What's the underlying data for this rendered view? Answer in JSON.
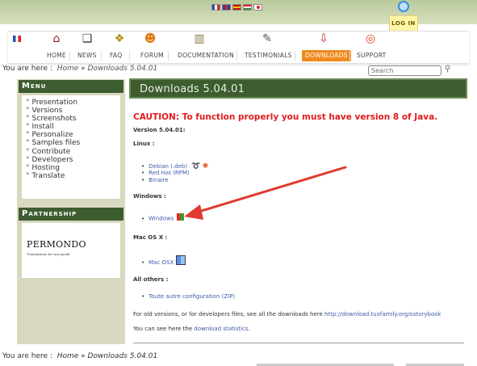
{
  "login": {
    "label": "LOG IN"
  },
  "nav": {
    "items": [
      {
        "label": "Home",
        "icon": "home-icon"
      },
      {
        "label": "News",
        "icon": "news-icon"
      },
      {
        "label": "FAQ",
        "icon": "faq-icon"
      },
      {
        "label": "Forum",
        "icon": "forum-icon"
      },
      {
        "label": "Documentation",
        "icon": "documentation-icon"
      },
      {
        "label": "Testimonials",
        "icon": "testimonials-icon"
      },
      {
        "label": "Downloads",
        "icon": "download-icon",
        "active": true
      },
      {
        "label": "Support",
        "icon": "lifebuoy-icon"
      }
    ]
  },
  "breadcrumb": {
    "prefix": "You are here :",
    "home": "Home",
    "sep": "»",
    "current": "Downloads 5.04.01"
  },
  "search": {
    "placeholder": "Search"
  },
  "sidebar": {
    "menu_title": "Menu",
    "items": [
      "Presentation",
      "Versions",
      "Screenshots",
      "Install",
      "Personalize",
      "Samples files",
      "Contribute",
      "Developers",
      "Hosting",
      "Translate"
    ],
    "partnership_title": "Partnership",
    "partner_name": "PERMONDO",
    "partner_tagline": "Translations for non-profit"
  },
  "main": {
    "title": "Downloads 5.04.01",
    "caution": "CAUTION: To function properly you must have version 8 of Java.",
    "version_label": "Version 5.04.01:",
    "linux_label": "Linux :",
    "linux_links": [
      "Debian (.deb)",
      "Red Hat (RPM)",
      "Binaire"
    ],
    "windows_label": "Windows :",
    "windows_link": "Windows",
    "mac_label": "Mac OS X :",
    "mac_link": "Mac OSX",
    "others_label": "All others :",
    "others_link": "Toute autre configuration (ZIP)",
    "old_versions_text": "For old versions, or for developers files, see all the downloads here",
    "old_versions_link": "http://download.tuxfamily.org/ostorybook",
    "stats_prefix": "You can see here the",
    "stats_link": "download statistics",
    "stats_suffix": "."
  },
  "colors": {
    "accent": "#f08a1e",
    "header_green": "#3d5c30",
    "caution_red": "#e21b1b",
    "link": "#3f5ba9",
    "arrow": "#e03a2e"
  }
}
